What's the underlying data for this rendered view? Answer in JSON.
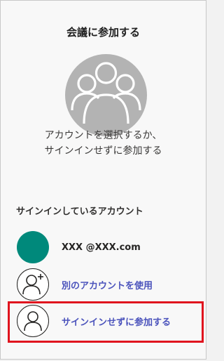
{
  "dialog": {
    "title": "会議に参加する",
    "subtitle_line1": "アカウントを選択するか、",
    "subtitle_line2": "サインインせずに参加する"
  },
  "accounts": {
    "heading": "サインインしているアカウント",
    "signed_in_account": "XXX @XXX.com",
    "signed_in_avatar_color": "#00897b",
    "use_other_account": "別のアカウントを使用",
    "join_without_signin": "サインインせずに参加する"
  },
  "icons": {
    "hero": "group-icon",
    "add_account": "person-add-icon",
    "guest": "person-icon"
  },
  "colors": {
    "link": "#4b53bc",
    "highlight": "#e0141e",
    "hero_bg": "#b3b3b3"
  }
}
